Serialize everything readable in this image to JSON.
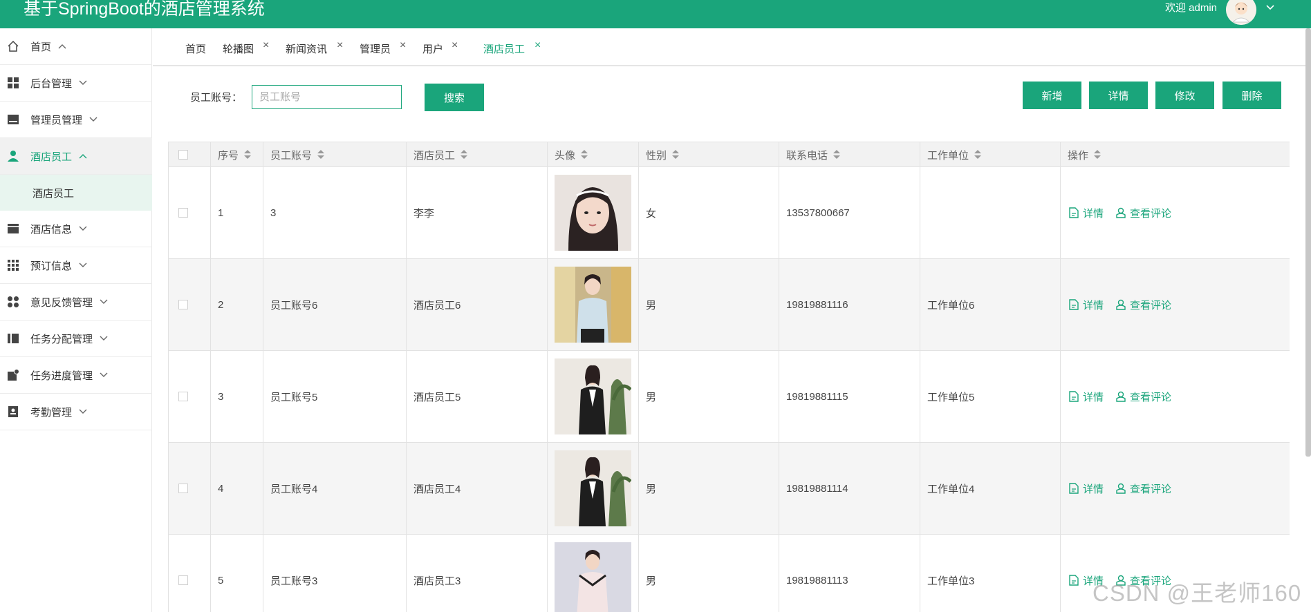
{
  "header": {
    "app_title": "基于SpringBoot的酒店管理系统",
    "welcome": "欢迎 admin"
  },
  "sidebar": {
    "items": [
      {
        "label": "首页",
        "icon": "home-icon",
        "chevron": "^"
      },
      {
        "label": "后台管理",
        "icon": "dashboard-icon",
        "chevron": "v"
      },
      {
        "label": "管理员管理",
        "icon": "admin-icon",
        "chevron": "v"
      },
      {
        "label": "酒店员工",
        "icon": "user-icon",
        "chevron": "^"
      },
      {
        "label": "酒店信息",
        "icon": "hotel-info-icon",
        "chevron": "v"
      },
      {
        "label": "预订信息",
        "icon": "grid-icon",
        "chevron": "v"
      },
      {
        "label": "意见反馈管理",
        "icon": "feedback-icon",
        "chevron": "v"
      },
      {
        "label": "任务分配管理",
        "icon": "task-assign-icon",
        "chevron": "v"
      },
      {
        "label": "任务进度管理",
        "icon": "task-progress-icon",
        "chevron": "v"
      },
      {
        "label": "考勤管理",
        "icon": "attendance-icon",
        "chevron": "v"
      }
    ],
    "sub_item": "酒店员工"
  },
  "tabs": [
    {
      "label": "首页",
      "closable": false
    },
    {
      "label": "轮播图",
      "closable": true
    },
    {
      "label": "新闻资讯",
      "closable": true
    },
    {
      "label": "管理员",
      "closable": true
    },
    {
      "label": "用户",
      "closable": true
    },
    {
      "label": "酒店员工",
      "closable": true,
      "active": true
    }
  ],
  "tab_close": "×",
  "search": {
    "label": "员工账号：",
    "placeholder": "员工账号",
    "button": "搜索"
  },
  "actions": {
    "add": "新增",
    "detail": "详情",
    "edit": "修改",
    "delete": "删除"
  },
  "table": {
    "columns": [
      "序号",
      "员工账号",
      "酒店员工",
      "头像",
      "性别",
      "联系电话",
      "工作单位",
      "操作"
    ],
    "rows": [
      {
        "index": "1",
        "account": "3",
        "name": "李李",
        "gender": "女",
        "phone": "13537800667",
        "unit": ""
      },
      {
        "index": "2",
        "account": "员工账号6",
        "name": "酒店员工6",
        "gender": "男",
        "phone": "19819881116",
        "unit": "工作单位6"
      },
      {
        "index": "3",
        "account": "员工账号5",
        "name": "酒店员工5",
        "gender": "男",
        "phone": "19819881115",
        "unit": "工作单位5"
      },
      {
        "index": "4",
        "account": "员工账号4",
        "name": "酒店员工4",
        "gender": "男",
        "phone": "19819881114",
        "unit": "工作单位4"
      },
      {
        "index": "5",
        "account": "员工账号3",
        "name": "酒店员工3",
        "gender": "男",
        "phone": "19819881113",
        "unit": "工作单位3"
      }
    ],
    "row_actions": {
      "detail": "详情",
      "comments": "查看评论"
    }
  },
  "watermark": "CSDN @王老师160",
  "colors": {
    "primary": "#1aa57b"
  }
}
